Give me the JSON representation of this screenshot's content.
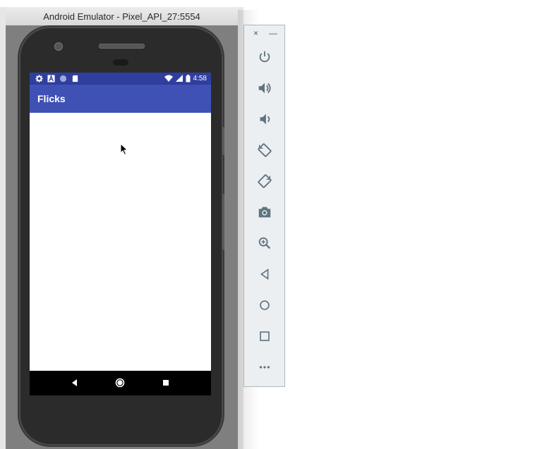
{
  "window": {
    "title": "Android Emulator - Pixel_API_27:5554"
  },
  "phone": {
    "status_bar": {
      "time": "4:58",
      "left_icons": [
        "settings-icon",
        "a-letter-icon",
        "circle-icon",
        "sd-card-icon"
      ],
      "right_icons": [
        "wifi-icon",
        "signal-icon",
        "battery-icon"
      ]
    },
    "app_bar": {
      "title": "Flicks"
    },
    "nav_bar": [
      "back-icon",
      "home-icon",
      "recents-icon"
    ],
    "colors": {
      "status_bar": "#303f9f",
      "app_bar": "#3f51b5",
      "content": "#ffffff",
      "nav_bar": "#000000"
    }
  },
  "toolbar": {
    "close_label": "×",
    "minimize_label": "—",
    "buttons": [
      "power-icon",
      "volume-up-icon",
      "volume-down-icon",
      "rotate-left-icon",
      "rotate-right-icon",
      "camera-icon",
      "zoom-icon",
      "back-icon",
      "home-icon",
      "overview-icon",
      "more-icon"
    ],
    "icon_color": "#5f7380"
  }
}
